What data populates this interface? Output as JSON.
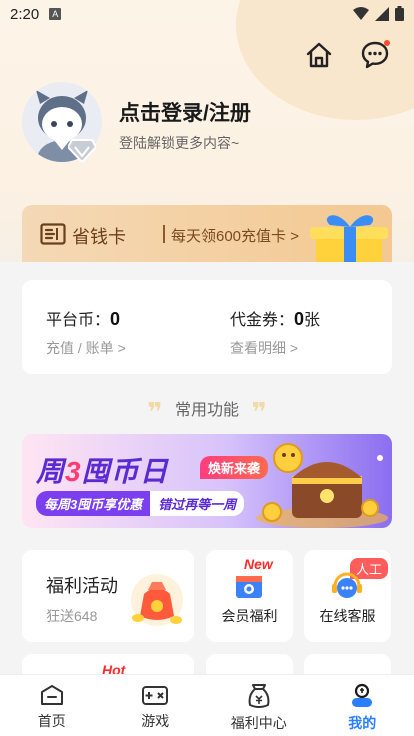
{
  "status_bar": {
    "time": "2:20",
    "a_label": "A"
  },
  "profile": {
    "login_title": "点击登录/注册",
    "login_subtitle": "登陆解锁更多内容~"
  },
  "saver_card": {
    "name": "省钱卡",
    "description": "每天领600充值卡",
    "arrow": ">"
  },
  "wallet": {
    "platform_coin_label": "平台币：",
    "platform_coin_value": "0",
    "platform_coin_link": "充值 / 账单",
    "voucher_label": "代金券：",
    "voucher_value": "0",
    "voucher_unit": "张",
    "voucher_link": "查看明细",
    "link_arrow": ">"
  },
  "common_features": {
    "title": "常用功能",
    "quote_left": "❞",
    "quote_right": "❞"
  },
  "banner": {
    "title_a": "周",
    "title_num": "3",
    "title_b": "囤币日",
    "tag": "焕新来袭",
    "sub_a": "每周3囤币享优惠",
    "sub_b": "错过再等一周"
  },
  "features": [
    {
      "title": "福利活动",
      "subtitle": "狂送648"
    },
    {
      "title": "会员福利",
      "badge": "New"
    },
    {
      "title": "在线客服",
      "badge": "人工"
    }
  ],
  "row2": {
    "badge": "Hot"
  },
  "tabbar": {
    "items": [
      {
        "label": "首页",
        "icon": "home-icon"
      },
      {
        "label": "游戏",
        "icon": "gamepad-icon"
      },
      {
        "label": "福利中心",
        "icon": "welfare-bag-icon"
      },
      {
        "label": "我的",
        "icon": "profile-icon",
        "active": true
      }
    ]
  },
  "colors": {
    "accent_blue": "#2b7fff",
    "saver_brown": "#6b3f1c",
    "banner_purple": "#5a2bd3",
    "badge_red": "#ff2a2a"
  }
}
